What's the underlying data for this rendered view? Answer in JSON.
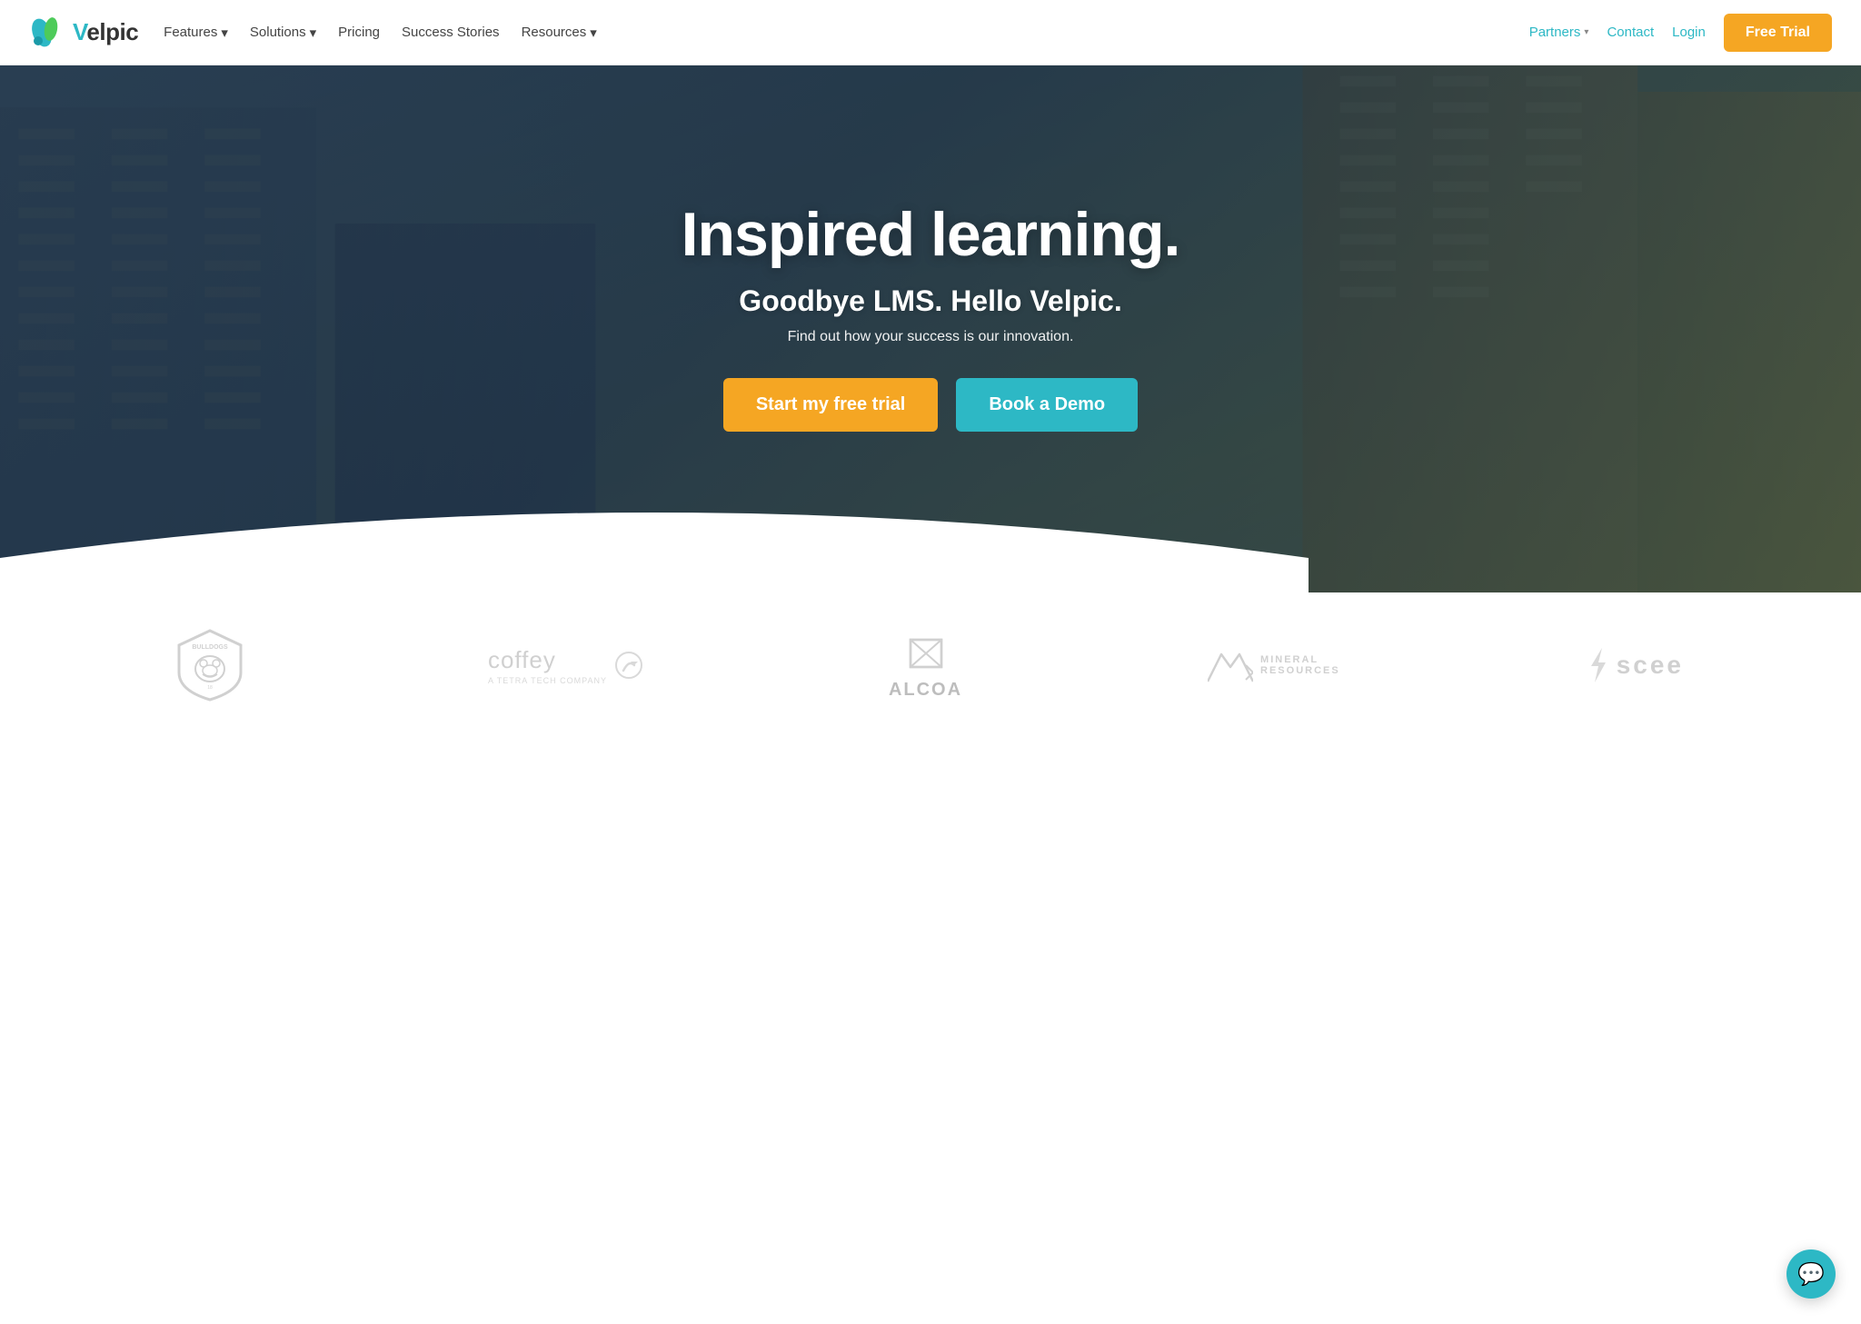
{
  "navbar": {
    "logo_text": "elpic",
    "nav_items": [
      {
        "label": "Features",
        "has_dropdown": true
      },
      {
        "label": "Solutions",
        "has_dropdown": true
      },
      {
        "label": "Pricing",
        "has_dropdown": false
      },
      {
        "label": "Success Stories",
        "has_dropdown": false
      },
      {
        "label": "Resources",
        "has_dropdown": true
      }
    ],
    "nav_right_items": [
      {
        "label": "Partners",
        "has_dropdown": true
      },
      {
        "label": "Contact",
        "has_dropdown": false
      },
      {
        "label": "Login",
        "has_dropdown": false
      }
    ],
    "free_trial_label": "Free Trial"
  },
  "hero": {
    "title": "Inspired learning.",
    "subtitle": "Goodbye LMS. Hello Velpic.",
    "description": "Find out how your success is our innovation.",
    "btn_trial_label": "Start my free trial",
    "btn_demo_label": "Book a Demo"
  },
  "logos": [
    {
      "name": "bulldogs",
      "type": "svg"
    },
    {
      "name": "coffey",
      "type": "text",
      "text": "coffey",
      "sub": "A TETRA TECH COMPANY"
    },
    {
      "name": "alcoa",
      "type": "text",
      "text": "ALCOA"
    },
    {
      "name": "mineral-resources",
      "type": "text",
      "text1": "MINERAL",
      "text2": "RESOURCES"
    },
    {
      "name": "scee",
      "type": "text",
      "text": "scee"
    }
  ],
  "colors": {
    "orange": "#f5a623",
    "teal": "#2db8c5",
    "nav_link": "#444",
    "partner_link": "#2db8c5"
  },
  "chat": {
    "icon": "💬"
  }
}
